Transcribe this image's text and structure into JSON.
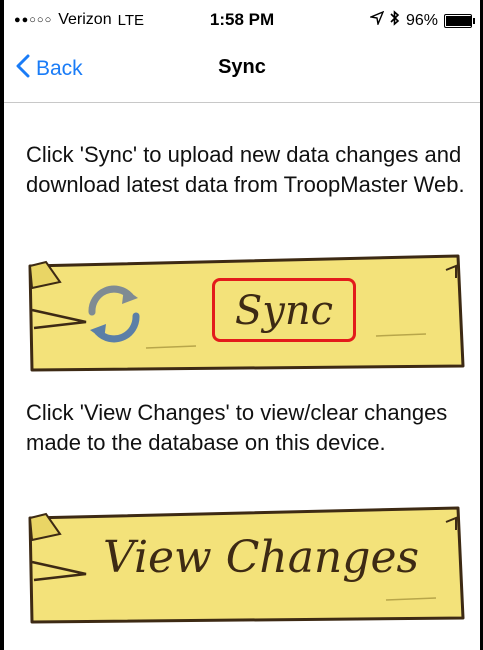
{
  "status": {
    "signal": "●●○○○",
    "carrier": "Verizon",
    "network": "LTE",
    "time": "1:58 PM",
    "battery": "96%",
    "battery_level": 0.96
  },
  "nav": {
    "back_label": "Back",
    "title": "Sync"
  },
  "content": {
    "sync_instructions": "Click 'Sync' to upload new data changes and download latest data from TroopMaster Web.",
    "sync_button_label": "Sync",
    "view_instructions": "Click 'View Changes' to view/clear changes made to the database on this device.",
    "view_button_label": "View Changes"
  },
  "colors": {
    "accent": "#1a7cf7",
    "plank": "#f3e27a",
    "highlight": "#e31b1b"
  }
}
